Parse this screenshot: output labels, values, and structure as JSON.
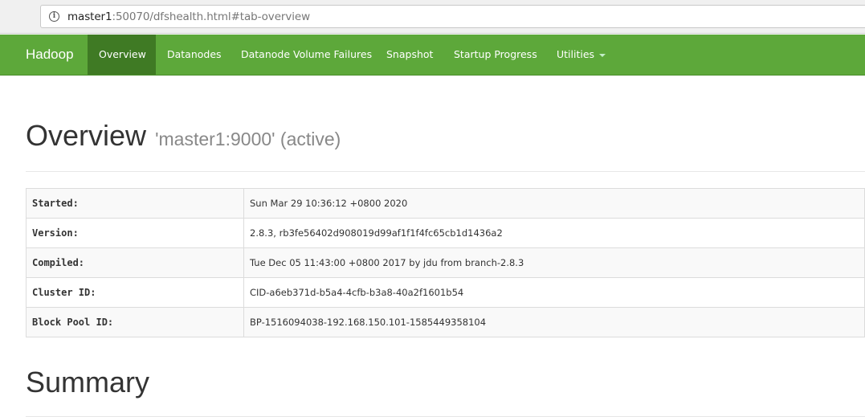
{
  "browser": {
    "url_host": "master1",
    "url_rest": ":50070/dfshealth.html#tab-overview"
  },
  "navbar": {
    "brand": "Hadoop",
    "items": [
      {
        "label": "Overview",
        "active": true
      },
      {
        "label": "Datanodes"
      },
      {
        "label": "Datanode Volume Failures"
      },
      {
        "label": "Snapshot"
      },
      {
        "label": "Startup Progress"
      },
      {
        "label": "Utilities"
      }
    ],
    "colors": {
      "bar": "#5da83a",
      "active": "#3f7a24"
    }
  },
  "overview": {
    "title": "Overview",
    "subtitle": "'master1:9000' (active)",
    "rows": [
      {
        "key": "Started:",
        "value": "Sun Mar 29 10:36:12 +0800 2020"
      },
      {
        "key": "Version:",
        "value": "2.8.3, rb3fe56402d908019d99af1f1f4fc65cb1d1436a2"
      },
      {
        "key": "Compiled:",
        "value": "Tue Dec 05 11:43:00 +0800 2017 by jdu from branch-2.8.3"
      },
      {
        "key": "Cluster ID:",
        "value": "CID-a6eb371d-b5a4-4cfb-b3a8-40a2f1601b54"
      },
      {
        "key": "Block Pool ID:",
        "value": "BP-1516094038-192.168.150.101-1585449358104"
      }
    ]
  },
  "summary": {
    "title": "Summary"
  }
}
